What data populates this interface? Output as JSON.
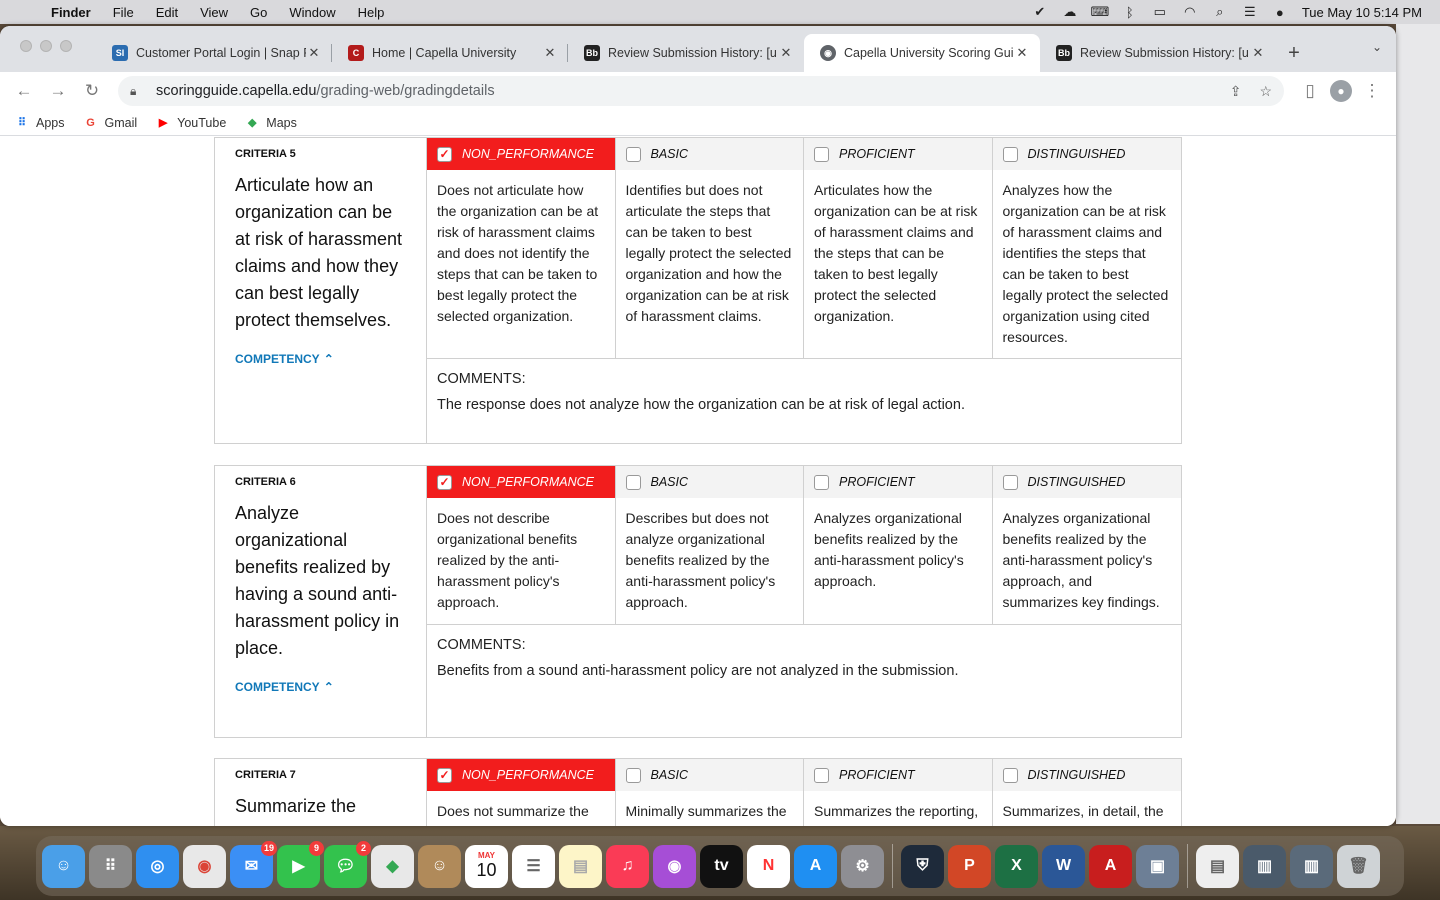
{
  "menubar": {
    "app": "Finder",
    "items": [
      "File",
      "Edit",
      "View",
      "Go",
      "Window",
      "Help"
    ],
    "clock": "Tue May 10  5:14 PM"
  },
  "tabs": [
    {
      "title": "Customer Portal Login | Snap Fi",
      "fav": "SI",
      "color": "#2b6cb0"
    },
    {
      "title": "Home | Capella University",
      "fav": "C",
      "color": "#b31b1b"
    },
    {
      "title": "Review Submission History: [u",
      "fav": "Bb",
      "color": "#222222"
    },
    {
      "title": "Capella University Scoring Gui",
      "fav": "◉",
      "color": "#5f6368"
    },
    {
      "title": "Review Submission History: [u",
      "fav": "Bb",
      "color": "#222222"
    }
  ],
  "address": {
    "host": "scoringguide.capella.edu",
    "path": "/grading-web/gradingdetails"
  },
  "bookmarks": [
    "Apps",
    "Gmail",
    "YouTube",
    "Maps"
  ],
  "levels": [
    "NON_PERFORMANCE",
    "BASIC",
    "PROFICIENT",
    "DISTINGUISHED"
  ],
  "competency_label": "COMPETENCY",
  "comments_label": "COMMENTS:",
  "criteria": [
    {
      "label": "CRITERIA 5",
      "text": "Articulate how an organization can be at risk of harassment claims and how they can best legally protect themselves.",
      "descriptions": [
        "Does not articulate how the organization can be at risk of harassment claims and does not identify the steps that can be taken to best legally protect the selected organization.",
        "Identifies but does not articulate the steps that can be taken to best legally protect the selected organization and how the organization can be at risk of harassment claims.",
        "Articulates how the organization can be at risk of harassment claims and the steps that can be taken to best legally protect the selected organization.",
        "Analyzes how the organization can be at risk of harassment claims and identifies the steps that can be taken to best legally protect the selected organization using cited resources."
      ],
      "comment": "The response does not analyze how the organization can be at risk of legal action."
    },
    {
      "label": "CRITERIA 6",
      "text": "Analyze organizational benefits realized by having a sound anti-harassment policy in place.",
      "descriptions": [
        "Does not describe organizational benefits realized by the anti-harassment policy's approach.",
        "Describes but does not analyze organizational benefits realized by the anti-harassment policy's approach.",
        "Analyzes organizational benefits realized by the anti-harassment policy's approach.",
        "Analyzes organizational benefits realized by the anti-harassment policy's approach, and summarizes key findings."
      ],
      "comment": "Benefits from a sound anti-harassment policy are not analyzed in the submission."
    },
    {
      "label": "CRITERIA 7",
      "text": "Summarize the",
      "descriptions": [
        "Does not summarize the",
        "Minimally summarizes the",
        "Summarizes the reporting,",
        "Summarizes, in detail, the"
      ]
    }
  ],
  "dock": {
    "mail_badge": "19",
    "facetime_badge": "9",
    "messages_badge": "2",
    "calendar_month": "MAY",
    "calendar_day": "10"
  }
}
